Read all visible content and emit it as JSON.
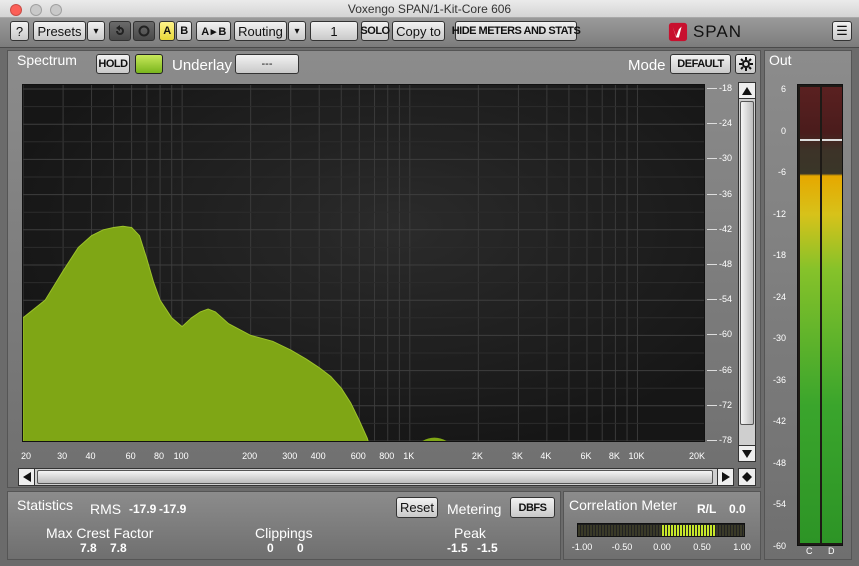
{
  "window": {
    "title": "Voxengo SPAN/1-Kit-Core 606"
  },
  "toolbar": {
    "help": "?",
    "presets": "Presets",
    "dropdown": "▾",
    "a": "A",
    "b": "B",
    "ab": "A ▸ B",
    "routing": "Routing",
    "routing_dd": "▾",
    "channel": "1",
    "solo": "SOLO",
    "copy_to": "Copy to",
    "hide_meters": "HIDE METERS AND STATS",
    "brand": "SPAN",
    "menu": "☰"
  },
  "spectrum": {
    "title": "Spectrum",
    "hold": "HOLD",
    "underlay_label": "Underlay",
    "underlay_value": "---",
    "mode_label": "Mode",
    "mode_value": "DEFAULT",
    "db_ticks": [
      "-18",
      "-24",
      "-30",
      "-36",
      "-42",
      "-48",
      "-54",
      "-60",
      "-66",
      "-72",
      "-78"
    ],
    "freq_ticks": [
      "20",
      "30",
      "40",
      "60",
      "80",
      "100",
      "200",
      "300",
      "400",
      "600",
      "800",
      "1K",
      "2K",
      "3K",
      "4K",
      "6K",
      "8K",
      "10K",
      "20K"
    ],
    "fill_color": "#7fa615"
  },
  "out": {
    "title": "Out",
    "scale": [
      "6",
      "0",
      "-6",
      "-12",
      "-18",
      "-24",
      "-30",
      "-36",
      "-42",
      "-48",
      "-54",
      "-60"
    ],
    "channels": [
      "C",
      "D"
    ]
  },
  "statistics": {
    "title": "Statistics",
    "rms_label": "RMS",
    "rms_l": "-17.9",
    "rms_r": "-17.9",
    "reset": "Reset",
    "metering_label": "Metering",
    "metering_value": "DBFS",
    "crest_label": "Max Crest Factor",
    "crest_l": "7.8",
    "crest_r": "7.8",
    "clip_label": "Clippings",
    "clip_l": "0",
    "clip_r": "0",
    "peak_label": "Peak",
    "peak_l": "-1.5",
    "peak_r": "-1.5"
  },
  "correlation": {
    "title": "Correlation Meter",
    "rl_label": "R/L",
    "rl_value": "0.0",
    "scale": [
      "-1.00",
      "-0.50",
      "0.00",
      "0.50",
      "1.00"
    ]
  }
}
